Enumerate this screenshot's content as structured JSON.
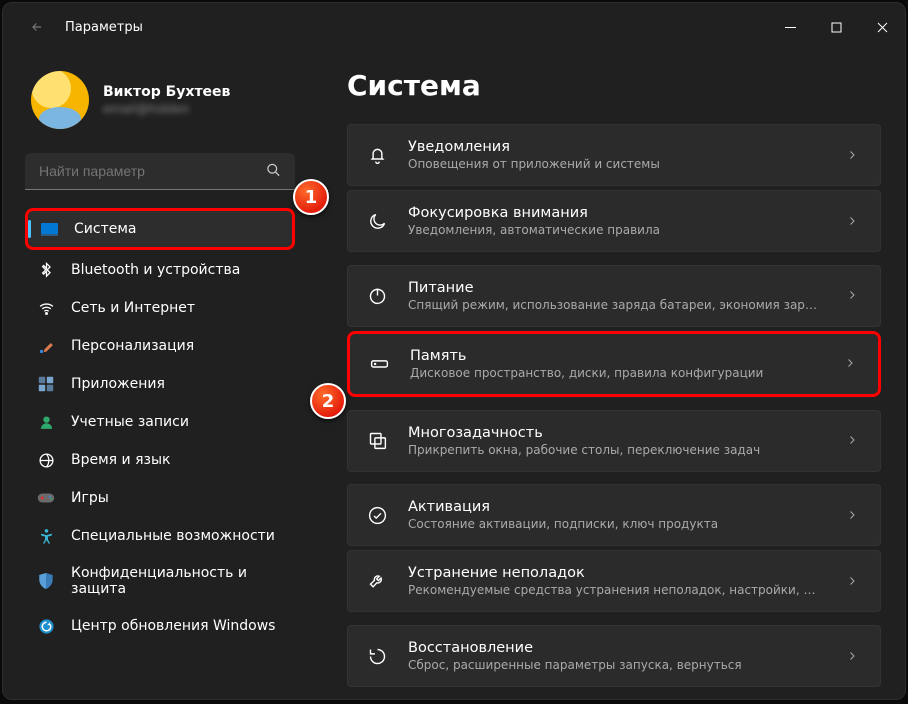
{
  "window_title": "Параметры",
  "profile": {
    "name": "Виктор Бухтеев",
    "email": "email@hidden"
  },
  "search": {
    "placeholder": "Найти параметр"
  },
  "sidebar": {
    "items": [
      {
        "label": "Система",
        "icon": "monitor",
        "selected": true
      },
      {
        "label": "Bluetooth и устройства",
        "icon": "bluetooth"
      },
      {
        "label": "Сеть и Интернет",
        "icon": "wifi"
      },
      {
        "label": "Персонализация",
        "icon": "brush"
      },
      {
        "label": "Приложения",
        "icon": "apps"
      },
      {
        "label": "Учетные записи",
        "icon": "person"
      },
      {
        "label": "Время и язык",
        "icon": "clock-globe"
      },
      {
        "label": "Игры",
        "icon": "gamepad"
      },
      {
        "label": "Специальные возможности",
        "icon": "accessibility"
      },
      {
        "label": "Конфиденциальность и защита",
        "icon": "shield"
      },
      {
        "label": "Центр обновления Windows",
        "icon": "update"
      }
    ]
  },
  "page": {
    "title": "Система"
  },
  "settings": [
    {
      "icon": "bell",
      "title": "Уведомления",
      "desc": "Оповещения от приложений и системы"
    },
    {
      "icon": "moon",
      "title": "Фокусировка внимания",
      "desc": "Уведомления, автоматические правила"
    },
    {
      "icon": "power",
      "title": "Питание",
      "desc": "Спящий режим, использование заряда батареи, экономия заряда",
      "gap_before": true
    },
    {
      "icon": "storage",
      "title": "Память",
      "desc": "Дисковое пространство, диски, правила конфигурации",
      "highlight": true
    },
    {
      "icon": "multitask",
      "title": "Многозадачность",
      "desc": "Прикрепить окна, рабочие столы, переключение задач",
      "gap_before": true
    },
    {
      "icon": "check-circle",
      "title": "Активация",
      "desc": "Состояние активации, подписки, ключ продукта",
      "gap_before": true
    },
    {
      "icon": "wrench",
      "title": "Устранение неполадок",
      "desc": "Рекомендуемые средства устранения неполадок, настройки, журнал"
    },
    {
      "icon": "recovery",
      "title": "Восстановление",
      "desc": "Сброс, расширенные параметры запуска, вернуться",
      "gap_before": true
    }
  ],
  "callouts": {
    "1": "1",
    "2": "2"
  }
}
